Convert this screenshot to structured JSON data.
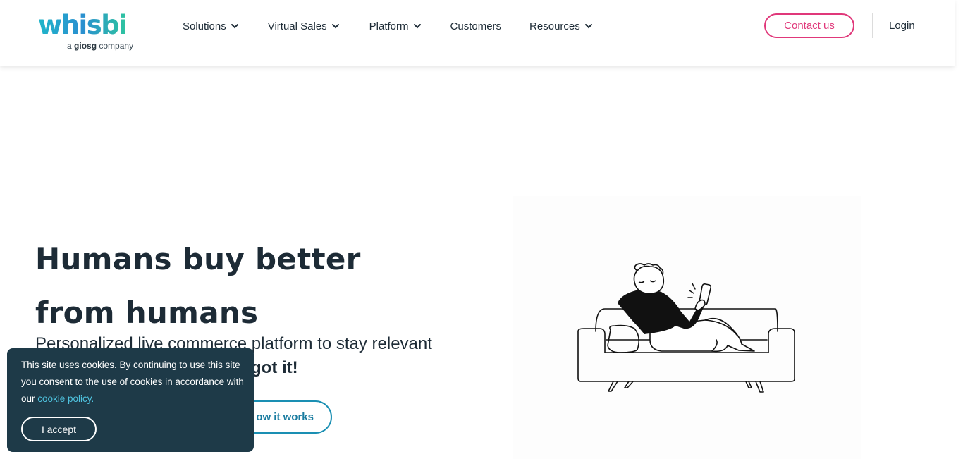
{
  "brand": {
    "name": "Whisbi",
    "tagline_prefix": "a",
    "tagline_brand": "giosg",
    "tagline_suffix": "company",
    "colors": {
      "teal": "#1fb5c9",
      "blue": "#2a7fd0",
      "green": "#2ec4a0",
      "pink": "#e0387a",
      "dark": "#1d2b36",
      "banner": "#1e3a48"
    }
  },
  "nav": {
    "items": [
      {
        "label": "Solutions",
        "has_dropdown": true,
        "icon": "chevron-down-icon"
      },
      {
        "label": "Virtual Sales",
        "has_dropdown": true,
        "icon": "chevron-down-icon"
      },
      {
        "label": "Platform",
        "has_dropdown": true,
        "icon": "chevron-down-icon"
      },
      {
        "label": "Customers",
        "has_dropdown": false
      },
      {
        "label": "Resources",
        "has_dropdown": true,
        "icon": "chevron-down-icon"
      }
    ],
    "contact_label": "Contact us",
    "login_label": "Login"
  },
  "hero": {
    "title_line1": "Humans buy better",
    "title_line2": "from humans",
    "subtitle": "Personalized live commerce platform to stay relevant",
    "subtitle_bold": "got it!",
    "cta_label": "ow it works"
  },
  "cookie_banner": {
    "text": "This site uses cookies. By continuing to use this site you consent to the use of cookies in accordance with our ",
    "link_label": "cookie policy.",
    "accept_label": "I accept"
  }
}
